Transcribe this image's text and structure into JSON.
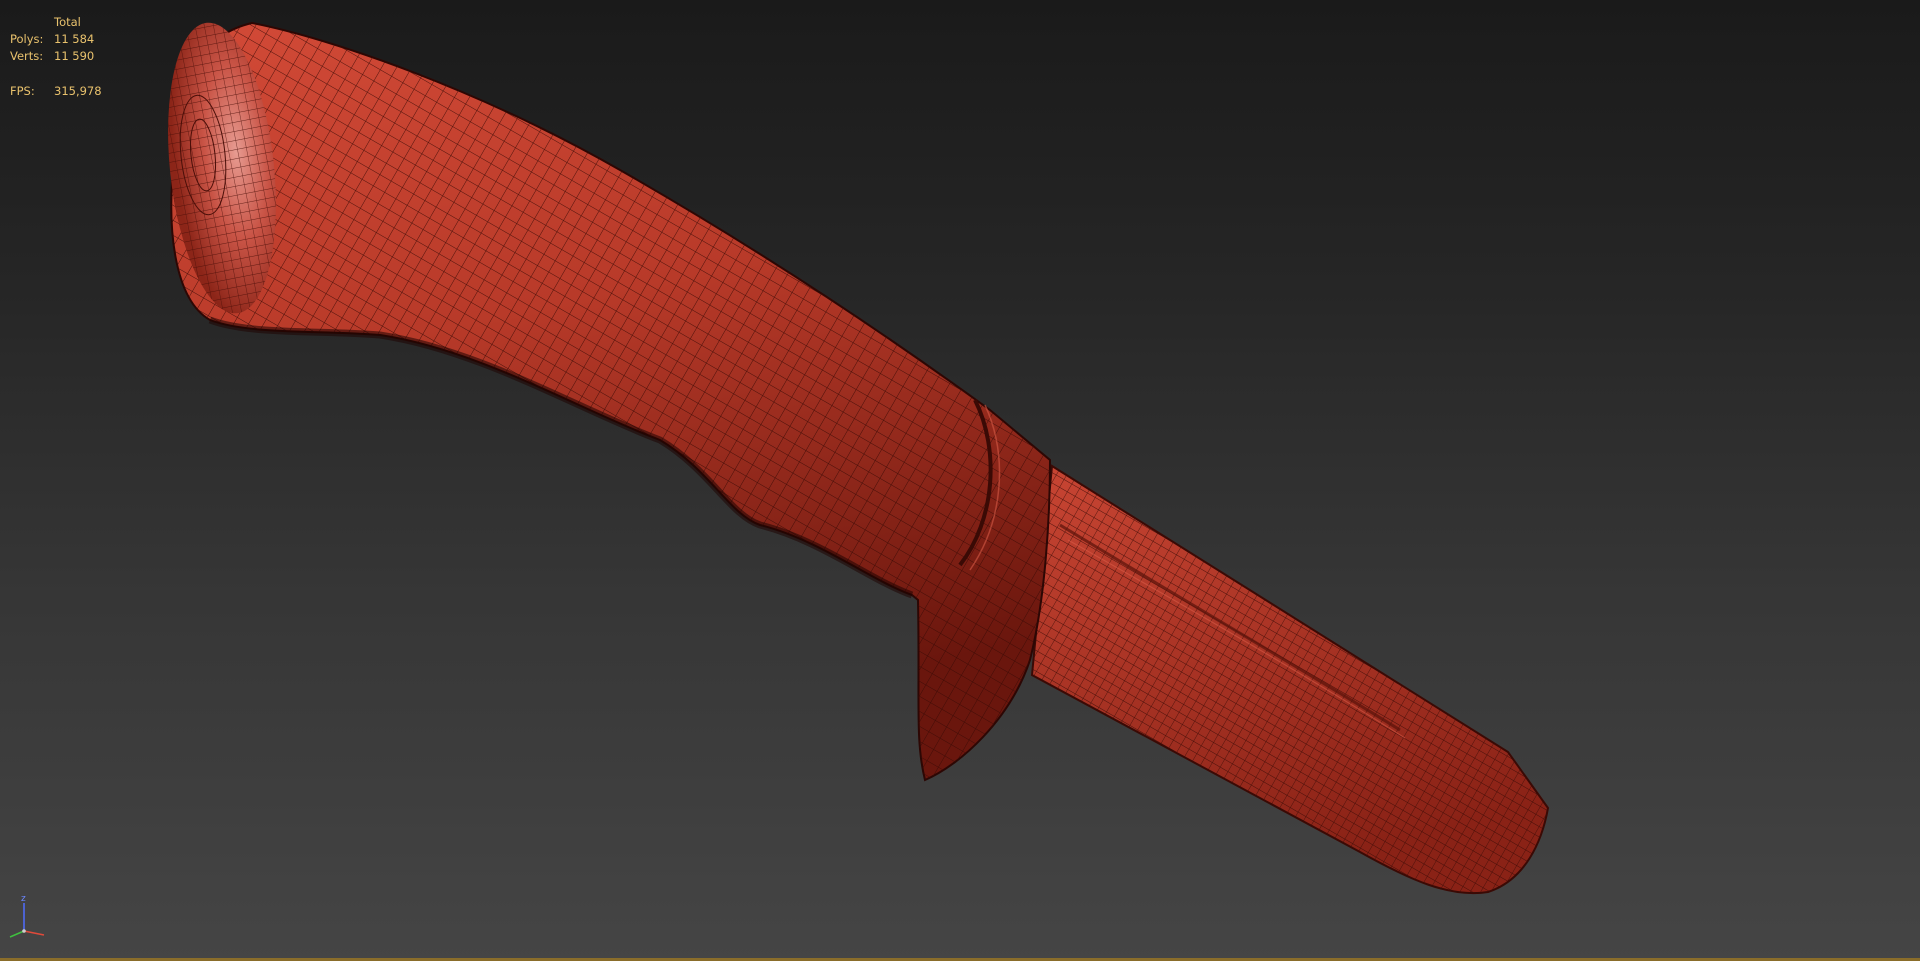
{
  "viewport": {
    "stats": {
      "header": "Total",
      "polys_label": "Polys:",
      "polys_value": "11 584",
      "verts_label": "Verts:",
      "verts_value": "11 590",
      "fps_label": "FPS:",
      "fps_value": "315,978"
    },
    "axis_gizmo": {
      "z_label": "z"
    },
    "colors": {
      "mesh_fill": "#b93a2a",
      "mesh_shadow": "#5e130c",
      "wire": "#3a0b06",
      "stats_text": "#e9c26d",
      "background_top": "#1a1a1a",
      "background_bottom": "#454545"
    }
  }
}
